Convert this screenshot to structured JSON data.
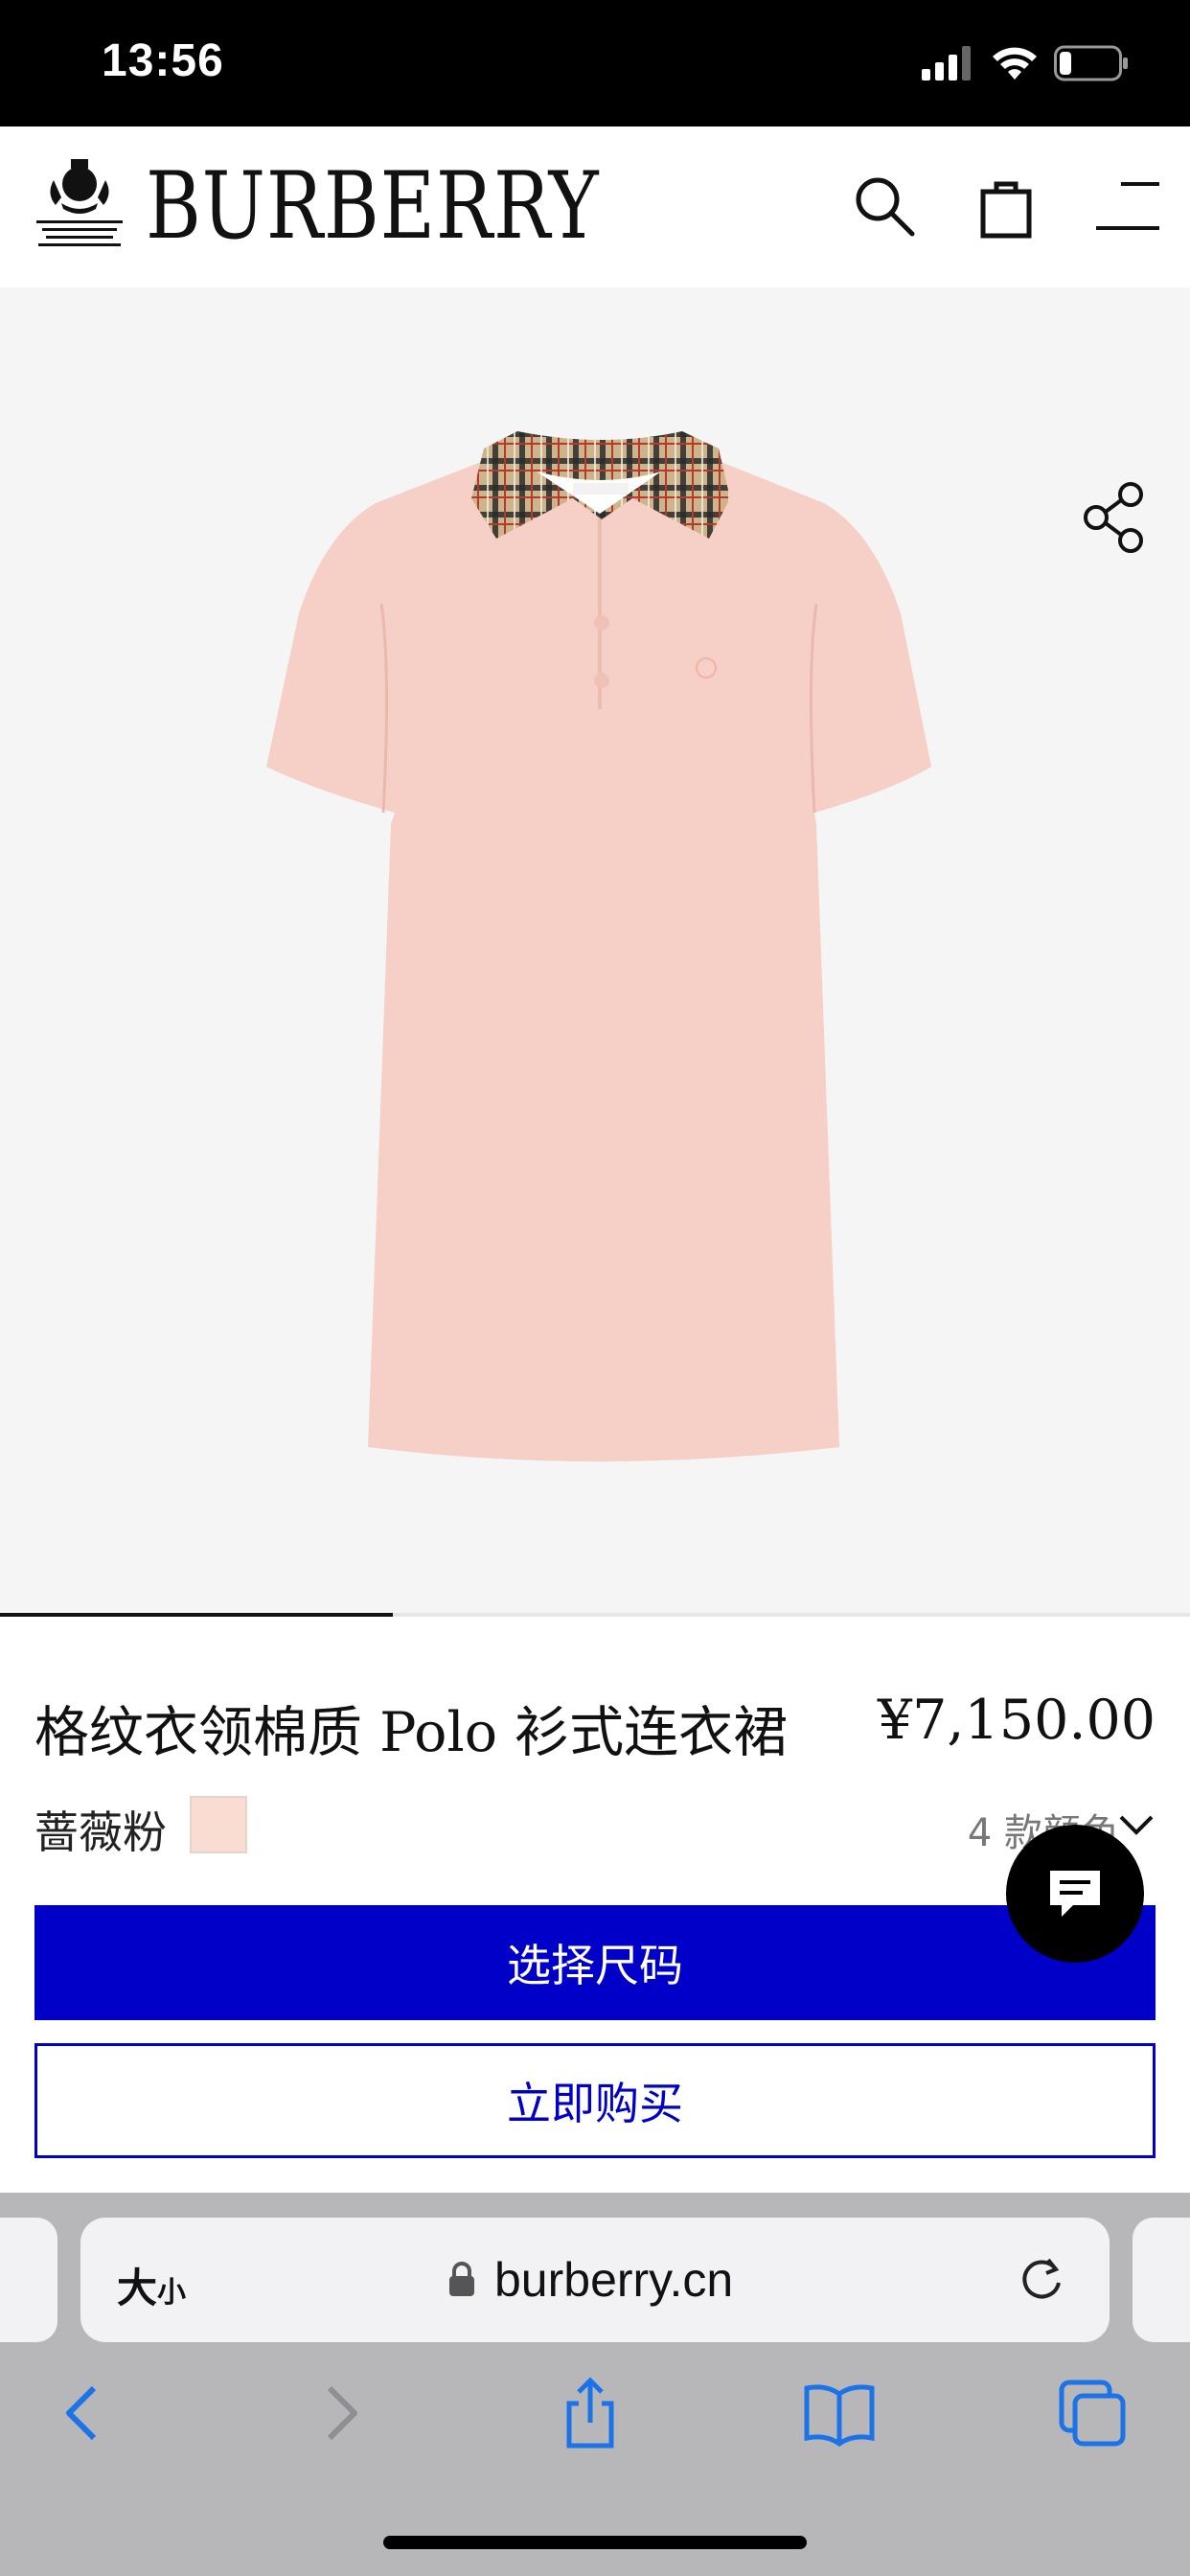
{
  "status_bar": {
    "time": "13:56",
    "battery_level": 0.2
  },
  "header": {
    "brand": "BURBERRY"
  },
  "product": {
    "name": "格纹衣领棉质 Polo 衫式连衣裙",
    "price": "¥7,150.00",
    "color_name": "蔷薇粉",
    "color_swatch": "#f9ddd3",
    "color_count": "4 款颜色",
    "image_index_fraction": 0.33
  },
  "actions": {
    "select_size": "选择尺码",
    "buy_now": "立即购买"
  },
  "browser": {
    "text_size": "大",
    "text_size_small": "小",
    "url": "burberry.cn"
  },
  "colors": {
    "accent_blue": "#0000c8",
    "dress_pink": "#f6cfc6"
  }
}
